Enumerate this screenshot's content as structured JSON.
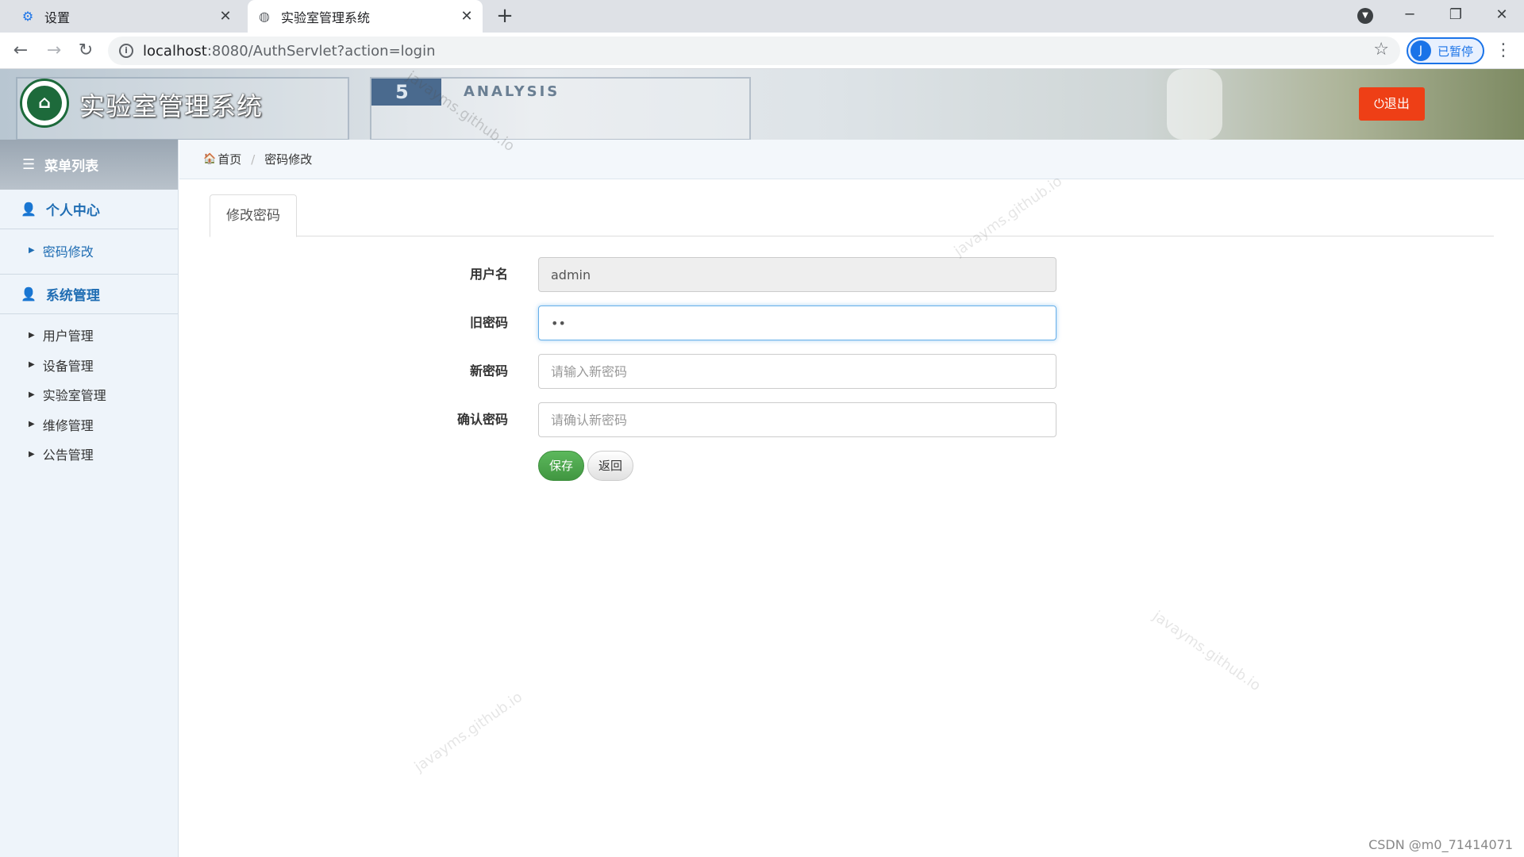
{
  "browser": {
    "tabs": [
      {
        "title": "设置",
        "icon": "gear-icon"
      },
      {
        "title": "实验室管理系统",
        "icon": "globe-icon"
      }
    ],
    "url_host": "localhost",
    "url_path": ":8080/AuthServlet?action=login",
    "profile_initial": "J",
    "profile_label": "已暂停"
  },
  "header": {
    "title": "实验室管理系统",
    "logout_label": "退出",
    "deco_number": "5",
    "deco_text": "ANALYSIS"
  },
  "sidebar": {
    "title": "菜单列表",
    "groups": [
      {
        "label": "个人中心",
        "items": [
          "密码修改"
        ]
      },
      {
        "label": "系统管理",
        "items": [
          "用户管理",
          "设备管理",
          "实验室管理",
          "维修管理",
          "公告管理"
        ]
      }
    ]
  },
  "breadcrumb": {
    "home": "首页",
    "current": "密码修改"
  },
  "form": {
    "tab_label": "修改密码",
    "username_label": "用户名",
    "username_value": "admin",
    "old_password_label": "旧密码",
    "old_password_value": "••",
    "new_password_label": "新密码",
    "new_password_placeholder": "请输入新密码",
    "confirm_password_label": "确认密码",
    "confirm_password_placeholder": "请确认新密码",
    "save_label": "保存",
    "back_label": "返回"
  },
  "watermark_text": "javayms.github.io",
  "footer_credit": "CSDN @m0_71414071",
  "colors": {
    "accent": "#1f6db3",
    "logout": "#ee3f16",
    "save": "#449d44"
  }
}
